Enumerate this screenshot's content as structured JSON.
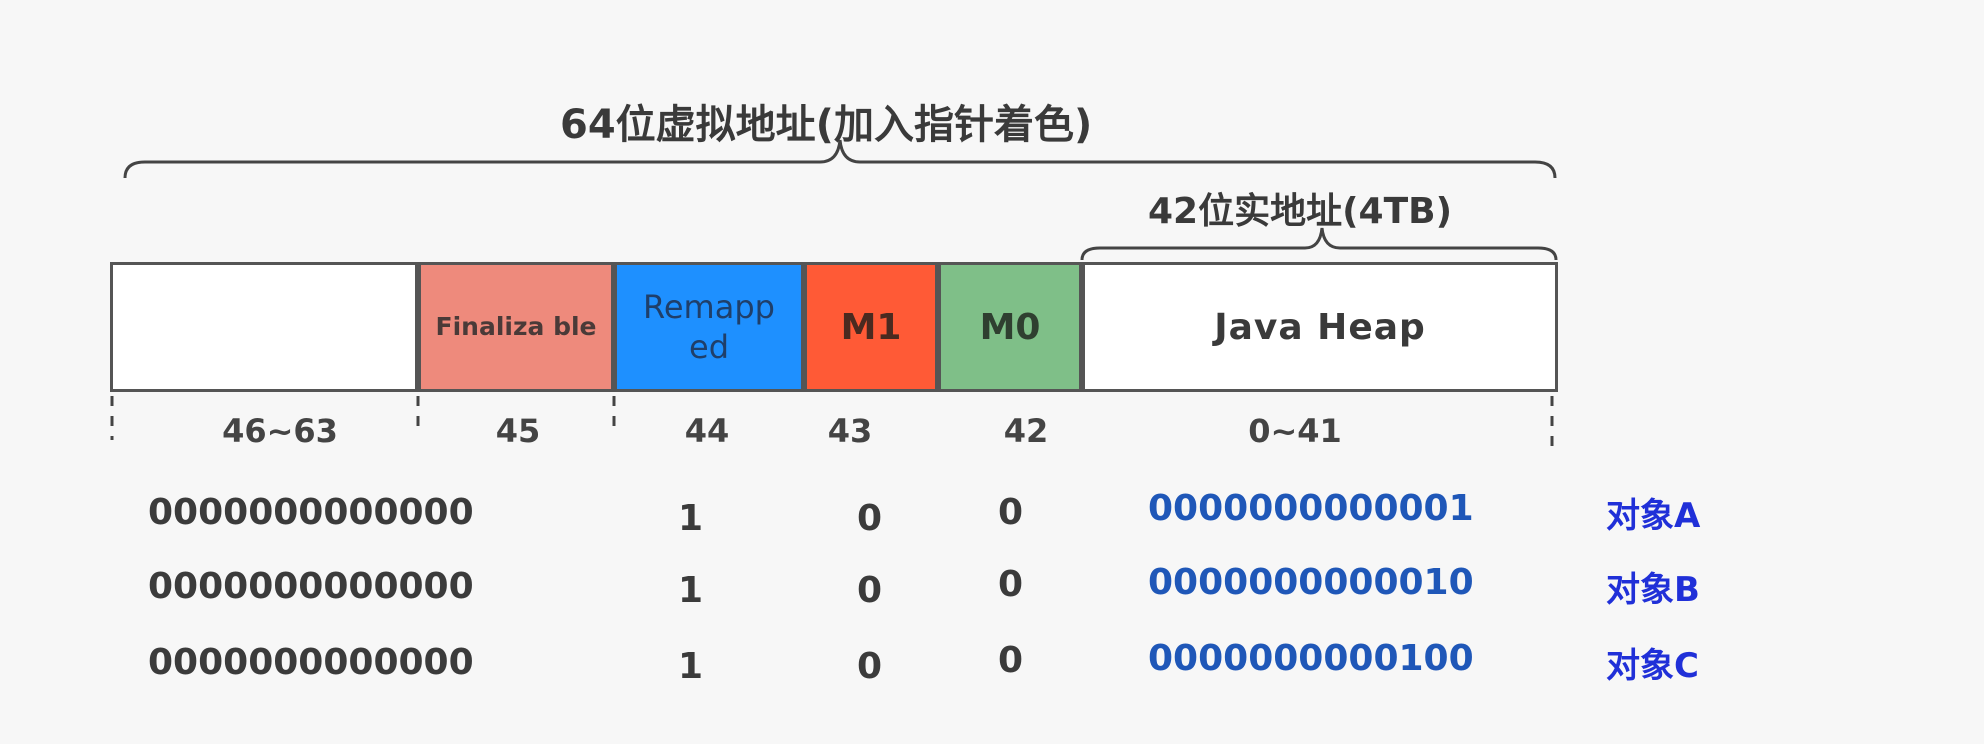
{
  "labels": {
    "virtual_address": "64位虚拟地址(加入指针着色)",
    "real_address": "42位实地址(4TB)"
  },
  "segments": {
    "unused": "",
    "finalizable": "Finaliza ble",
    "remapped": "Remapp ed",
    "m1": "M1",
    "m0": "M0",
    "heap": "Java Heap"
  },
  "bits": {
    "unused": "46~63",
    "finalizable": "45",
    "remapped": "44",
    "m1": "43",
    "m0": "42",
    "heap": "0~41"
  },
  "rows": [
    {
      "high": "0000000000000",
      "remapped": "1",
      "m1": "0",
      "m0": "0",
      "address": "0000000000001",
      "object": "对象A"
    },
    {
      "high": "0000000000000",
      "remapped": "1",
      "m1": "0",
      "m0": "0",
      "address": "0000000000010",
      "object": "对象B"
    },
    {
      "high": "0000000000000",
      "remapped": "1",
      "m1": "0",
      "m0": "0",
      "address": "0000000000100",
      "object": "对象C"
    }
  ],
  "colors": {
    "finalizable": "#ee8a7c",
    "remapped": "#1e90ff",
    "m1": "#ff5a36",
    "m0": "#7fbf88",
    "address_text": "#1f57b8",
    "object_text": "#2030d8"
  }
}
